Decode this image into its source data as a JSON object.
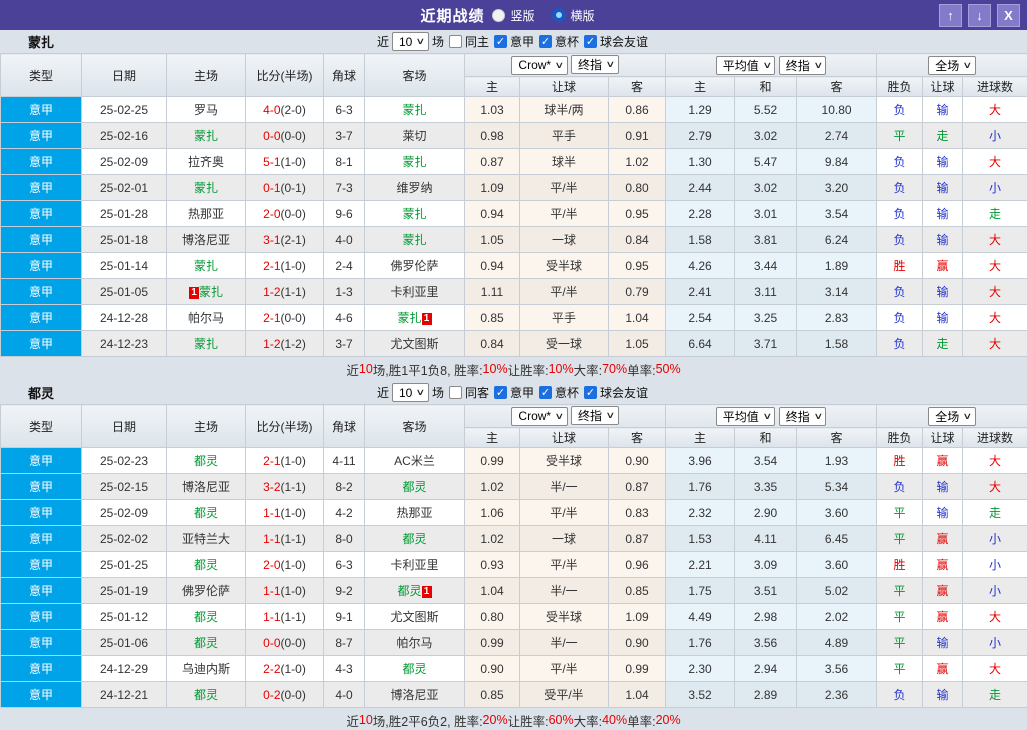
{
  "titlebar": {
    "title": "近期战绩",
    "radio_vertical": "竖版",
    "radio_horizontal": "横版"
  },
  "icons": {
    "up": "↑",
    "down": "↓",
    "close": "X",
    "chevron": "∨",
    "check": "✓"
  },
  "colors": {
    "titlebar_purple": "#4c4199",
    "button_purple": "#837bca",
    "league_cell_blue": "#00a2e8",
    "win_red": "#e60000",
    "draw_green": "#009933",
    "lose_blue": "#2233cc",
    "checkbox_blue": "#1b6fe0",
    "odds_cream": "#fcf5ee",
    "odds_blue": "#e8f3fa"
  },
  "header": {
    "left": [
      "类型",
      "日期",
      "主场",
      "比分(半场)",
      "角球",
      "客场"
    ],
    "selects": [
      "Crow*",
      "终指",
      "平均值",
      "终指",
      "全场"
    ],
    "sub": [
      "主",
      "让球",
      "客",
      "主",
      "和",
      "客",
      "胜负",
      "让球",
      "进球数"
    ]
  },
  "sections": [
    {
      "team": "蒙扎",
      "filter": {
        "prefix": "近",
        "count": "10",
        "suffix": "场",
        "same": "同主",
        "same_checked": false,
        "leagues": [
          "意甲",
          "意杯",
          "球会友谊"
        ]
      },
      "rows": [
        {
          "lg": "意甲",
          "dt": "25-02-25",
          "hm": "罗马",
          "sc": "4-0",
          "hf": "(2-0)",
          "cn": "6-3",
          "aw": "蒙扎",
          "o1": "1.03",
          "hd": "球半/两",
          "o2": "0.86",
          "a1": "1.29",
          "a2": "5.52",
          "a3": "10.80",
          "wl": "负",
          "hc": "输",
          "ou": "大"
        },
        {
          "lg": "意甲",
          "dt": "25-02-16",
          "hm": "蒙扎",
          "sc": "0-0",
          "hf": "(0-0)",
          "cn": "3-7",
          "aw": "莱切",
          "o1": "0.98",
          "hd": "平手",
          "o2": "0.91",
          "a1": "2.79",
          "a2": "3.02",
          "a3": "2.74",
          "wl": "平",
          "hc": "走",
          "ou": "小"
        },
        {
          "lg": "意甲",
          "dt": "25-02-09",
          "hm": "拉齐奥",
          "sc": "5-1",
          "hf": "(1-0)",
          "cn": "8-1",
          "aw": "蒙扎",
          "o1": "0.87",
          "hd": "球半",
          "o2": "1.02",
          "a1": "1.30",
          "a2": "5.47",
          "a3": "9.84",
          "wl": "负",
          "hc": "输",
          "ou": "大"
        },
        {
          "lg": "意甲",
          "dt": "25-02-01",
          "hm": "蒙扎",
          "sc": "0-1",
          "hf": "(0-1)",
          "cn": "7-3",
          "aw": "维罗纳",
          "o1": "1.09",
          "hd": "平/半",
          "o2": "0.80",
          "a1": "2.44",
          "a2": "3.02",
          "a3": "3.20",
          "wl": "负",
          "hc": "输",
          "ou": "小"
        },
        {
          "lg": "意甲",
          "dt": "25-01-28",
          "hm": "热那亚",
          "sc": "2-0",
          "hf": "(0-0)",
          "cn": "9-6",
          "aw": "蒙扎",
          "o1": "0.94",
          "hd": "平/半",
          "o2": "0.95",
          "a1": "2.28",
          "a2": "3.01",
          "a3": "3.54",
          "wl": "负",
          "hc": "输",
          "ou": "走"
        },
        {
          "lg": "意甲",
          "dt": "25-01-18",
          "hm": "博洛尼亚",
          "sc": "3-1",
          "hf": "(2-1)",
          "cn": "4-0",
          "aw": "蒙扎",
          "o1": "1.05",
          "hd": "一球",
          "o2": "0.84",
          "a1": "1.58",
          "a2": "3.81",
          "a3": "6.24",
          "wl": "负",
          "hc": "输",
          "ou": "大"
        },
        {
          "lg": "意甲",
          "dt": "25-01-14",
          "hm": "蒙扎",
          "sc": "2-1",
          "hf": "(1-0)",
          "cn": "2-4",
          "aw": "佛罗伦萨",
          "o1": "0.94",
          "hd": "受半球",
          "o2": "0.95",
          "a1": "4.26",
          "a2": "3.44",
          "a3": "1.89",
          "wl": "胜",
          "hc": "赢",
          "ou": "大"
        },
        {
          "lg": "意甲",
          "dt": "25-01-05",
          "hm": "蒙扎",
          "hb": "1",
          "hbp": "pre",
          "sc": "1-2",
          "hf": "(1-1)",
          "cn": "1-3",
          "aw": "卡利亚里",
          "o1": "1.11",
          "hd": "平/半",
          "o2": "0.79",
          "a1": "2.41",
          "a2": "3.11",
          "a3": "3.14",
          "wl": "负",
          "hc": "输",
          "ou": "大"
        },
        {
          "lg": "意甲",
          "dt": "24-12-28",
          "hm": "帕尔马",
          "sc": "2-1",
          "hf": "(0-0)",
          "cn": "4-6",
          "aw": "蒙扎",
          "ab": "1",
          "abp": "post",
          "o1": "0.85",
          "hd": "平手",
          "o2": "1.04",
          "a1": "2.54",
          "a2": "3.25",
          "a3": "2.83",
          "wl": "负",
          "hc": "输",
          "ou": "大"
        },
        {
          "lg": "意甲",
          "dt": "24-12-23",
          "hm": "蒙扎",
          "sc": "1-2",
          "hf": "(1-2)",
          "cn": "3-7",
          "aw": "尤文图斯",
          "o1": "0.84",
          "hd": "受一球",
          "o2": "1.05",
          "a1": "6.64",
          "a2": "3.71",
          "a3": "1.58",
          "wl": "负",
          "hc": "走",
          "ou": "大"
        }
      ],
      "summary": [
        {
          "t": "近",
          "r": false
        },
        {
          "t": "10",
          "r": true
        },
        {
          "t": "场,胜1平1负8, 胜率:",
          "r": false
        },
        {
          "t": "10%",
          "r": true
        },
        {
          "t": " 让胜率:",
          "r": false
        },
        {
          "t": "10%",
          "r": true
        },
        {
          "t": " 大率:",
          "r": false
        },
        {
          "t": "70%",
          "r": true
        },
        {
          "t": " 单率:",
          "r": false
        },
        {
          "t": "50%",
          "r": true
        }
      ]
    },
    {
      "team": "都灵",
      "filter": {
        "prefix": "近",
        "count": "10",
        "suffix": "场",
        "same": "同客",
        "same_checked": false,
        "leagues": [
          "意甲",
          "意杯",
          "球会友谊"
        ]
      },
      "rows": [
        {
          "lg": "意甲",
          "dt": "25-02-23",
          "hm": "都灵",
          "sc": "2-1",
          "hf": "(1-0)",
          "cn": "4-11",
          "aw": "AC米兰",
          "o1": "0.99",
          "hd": "受半球",
          "o2": "0.90",
          "a1": "3.96",
          "a2": "3.54",
          "a3": "1.93",
          "wl": "胜",
          "hc": "赢",
          "ou": "大"
        },
        {
          "lg": "意甲",
          "dt": "25-02-15",
          "hm": "博洛尼亚",
          "sc": "3-2",
          "hf": "(1-1)",
          "cn": "8-2",
          "aw": "都灵",
          "o1": "1.02",
          "hd": "半/一",
          "o2": "0.87",
          "a1": "1.76",
          "a2": "3.35",
          "a3": "5.34",
          "wl": "负",
          "hc": "输",
          "ou": "大"
        },
        {
          "lg": "意甲",
          "dt": "25-02-09",
          "hm": "都灵",
          "sc": "1-1",
          "hf": "(1-0)",
          "cn": "4-2",
          "aw": "热那亚",
          "o1": "1.06",
          "hd": "平/半",
          "o2": "0.83",
          "a1": "2.32",
          "a2": "2.90",
          "a3": "3.60",
          "wl": "平",
          "hc": "输",
          "ou": "走"
        },
        {
          "lg": "意甲",
          "dt": "25-02-02",
          "hm": "亚特兰大",
          "sc": "1-1",
          "hf": "(1-1)",
          "cn": "8-0",
          "aw": "都灵",
          "o1": "1.02",
          "hd": "一球",
          "o2": "0.87",
          "a1": "1.53",
          "a2": "4.11",
          "a3": "6.45",
          "wl": "平",
          "hc": "赢",
          "ou": "小"
        },
        {
          "lg": "意甲",
          "dt": "25-01-25",
          "hm": "都灵",
          "sc": "2-0",
          "hf": "(1-0)",
          "cn": "6-3",
          "aw": "卡利亚里",
          "o1": "0.93",
          "hd": "平/半",
          "o2": "0.96",
          "a1": "2.21",
          "a2": "3.09",
          "a3": "3.60",
          "wl": "胜",
          "hc": "赢",
          "ou": "小"
        },
        {
          "lg": "意甲",
          "dt": "25-01-19",
          "hm": "佛罗伦萨",
          "sc": "1-1",
          "hf": "(1-0)",
          "cn": "9-2",
          "aw": "都灵",
          "ab": "1",
          "abp": "post",
          "o1": "1.04",
          "hd": "半/一",
          "o2": "0.85",
          "a1": "1.75",
          "a2": "3.51",
          "a3": "5.02",
          "wl": "平",
          "hc": "赢",
          "ou": "小"
        },
        {
          "lg": "意甲",
          "dt": "25-01-12",
          "hm": "都灵",
          "sc": "1-1",
          "hf": "(1-1)",
          "cn": "9-1",
          "aw": "尤文图斯",
          "o1": "0.80",
          "hd": "受半球",
          "o2": "1.09",
          "a1": "4.49",
          "a2": "2.98",
          "a3": "2.02",
          "wl": "平",
          "hc": "赢",
          "ou": "大"
        },
        {
          "lg": "意甲",
          "dt": "25-01-06",
          "hm": "都灵",
          "sc": "0-0",
          "hf": "(0-0)",
          "cn": "8-7",
          "aw": "帕尔马",
          "o1": "0.99",
          "hd": "半/一",
          "o2": "0.90",
          "a1": "1.76",
          "a2": "3.56",
          "a3": "4.89",
          "wl": "平",
          "hc": "输",
          "ou": "小"
        },
        {
          "lg": "意甲",
          "dt": "24-12-29",
          "hm": "乌迪内斯",
          "sc": "2-2",
          "hf": "(1-0)",
          "cn": "4-3",
          "aw": "都灵",
          "o1": "0.90",
          "hd": "平/半",
          "o2": "0.99",
          "a1": "2.30",
          "a2": "2.94",
          "a3": "3.56",
          "wl": "平",
          "hc": "赢",
          "ou": "大"
        },
        {
          "lg": "意甲",
          "dt": "24-12-21",
          "hm": "都灵",
          "sc": "0-2",
          "hf": "(0-0)",
          "cn": "4-0",
          "aw": "博洛尼亚",
          "o1": "0.85",
          "hd": "受平/半",
          "o2": "1.04",
          "a1": "3.52",
          "a2": "2.89",
          "a3": "2.36",
          "wl": "负",
          "hc": "输",
          "ou": "走"
        }
      ],
      "summary": [
        {
          "t": "近",
          "r": false
        },
        {
          "t": "10",
          "r": true
        },
        {
          "t": "场,胜2平6负2, 胜率:",
          "r": false
        },
        {
          "t": "20%",
          "r": true
        },
        {
          "t": " 让胜率:",
          "r": false
        },
        {
          "t": "60%",
          "r": true
        },
        {
          "t": " 大率:",
          "r": false
        },
        {
          "t": "40%",
          "r": true
        },
        {
          "t": " 单率:",
          "r": false
        },
        {
          "t": "20%",
          "r": true
        }
      ]
    }
  ]
}
